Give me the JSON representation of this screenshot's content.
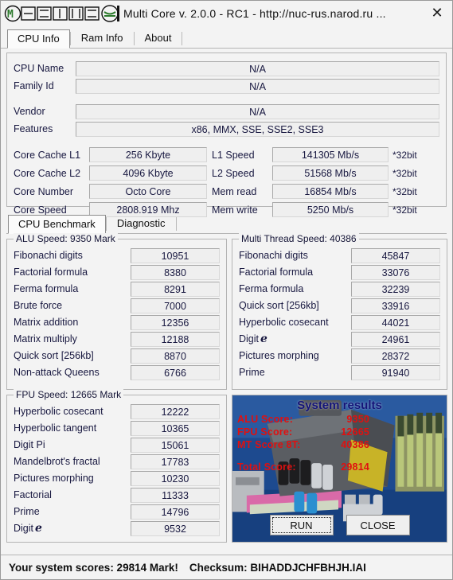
{
  "window": {
    "logo_text": "MOBILE",
    "title": "Multi Core   v. 2.0.0   -   RC1   -   http://nuc-rus.narod.ru ...",
    "close_icon": "close-icon"
  },
  "main_tabs": [
    {
      "label": "CPU Info",
      "selected": true
    },
    {
      "label": "Ram Info",
      "selected": false
    },
    {
      "label": "About",
      "selected": false
    }
  ],
  "cpu_info": {
    "rows": [
      {
        "label": "CPU Name",
        "value": "N/A"
      },
      {
        "label": "Family Id",
        "value": "N/A"
      },
      {
        "label": "Vendor",
        "value": "N/A"
      },
      {
        "label": "Features",
        "value": "x86, MMX, SSE, SSE2, SSE3"
      }
    ],
    "speed_rows": [
      {
        "label_left": "Core Cache L1",
        "value_left": "256 Kbyte",
        "label_right": "L1 Speed",
        "value_right": "141305 Mb/s",
        "bit": "*32bit"
      },
      {
        "label_left": "Core Cache L2",
        "value_left": "4096 Kbyte",
        "label_right": "L2 Speed",
        "value_right": "51568 Mb/s",
        "bit": "*32bit"
      },
      {
        "label_left": "Core Number",
        "value_left": "Octo Core",
        "label_right": "Mem read",
        "value_right": "16854 Mb/s",
        "bit": "*32bit"
      },
      {
        "label_left": "Core Speed",
        "value_left": "2808.919 Mhz",
        "label_right": "Mem write",
        "value_right": "5250 Mb/s",
        "bit": "*32bit"
      }
    ]
  },
  "bench_tabs": [
    {
      "label": "CPU Benchmark",
      "selected": true
    },
    {
      "label": "Diagnostic",
      "selected": false
    }
  ],
  "alu": {
    "legend": "ALU Speed: 9350 Mark",
    "rows": [
      {
        "label": "Fibonachi digits",
        "value": "10951"
      },
      {
        "label": "Factorial formula",
        "value": "8380"
      },
      {
        "label": "Ferma formula",
        "value": "8291"
      },
      {
        "label": "Brute force",
        "value": "7000"
      },
      {
        "label": "Matrix addition",
        "value": "12356"
      },
      {
        "label": "Matrix multiply",
        "value": "12188"
      },
      {
        "label": "Quick sort [256kb]",
        "value": "8870"
      },
      {
        "label": "Non-attack Queens",
        "value": "6766"
      }
    ]
  },
  "mt": {
    "legend": "Multi Thread Speed: 40386",
    "rows": [
      {
        "label": "Fibonachi digits",
        "value": "45847"
      },
      {
        "label": "Factorial formula",
        "value": "33076"
      },
      {
        "label": "Ferma formula",
        "value": "32239"
      },
      {
        "label": "Quick sort [256kb]",
        "value": "33916"
      },
      {
        "label": "Hyperbolic cosecant",
        "value": "44021"
      },
      {
        "label": "Digit",
        "suffix_e": "e",
        "value": "24961"
      },
      {
        "label": "Pictures morphing",
        "value": "28372"
      },
      {
        "label": "Prime",
        "value": "91940"
      }
    ]
  },
  "fpu": {
    "legend": "FPU Speed: 12665 Mark",
    "rows": [
      {
        "label": "Hyperbolic cosecant",
        "value": "12222"
      },
      {
        "label": "Hyperbolic tangent",
        "value": "10365"
      },
      {
        "label": "Digit Pi",
        "value": "15061"
      },
      {
        "label": "Mandelbrot's fractal",
        "value": "17783"
      },
      {
        "label": "Pictures morphing",
        "value": "10230"
      },
      {
        "label": "Factorial",
        "value": "11333"
      },
      {
        "label": "Prime",
        "value": "14796"
      },
      {
        "label": "Digit",
        "suffix_e": "e",
        "value": "9532"
      }
    ]
  },
  "system_results": {
    "title": "System results",
    "scores": [
      {
        "label": "ALU Score:",
        "value": "9350"
      },
      {
        "label": "FPU Score:",
        "value": "12665"
      },
      {
        "label": "MT Score 8T:",
        "value": "40386"
      }
    ],
    "total": {
      "label": "Total Score:",
      "value": "29814"
    },
    "run_button": "RUN",
    "close_button": "CLOSE",
    "title_color": "#141478",
    "score_color": "#e01010"
  },
  "statusbar": {
    "scores_text": "Your system scores: 29814 Mark!",
    "checksum_text": "Checksum: BIHADDJCHFBHJH.IAI"
  }
}
